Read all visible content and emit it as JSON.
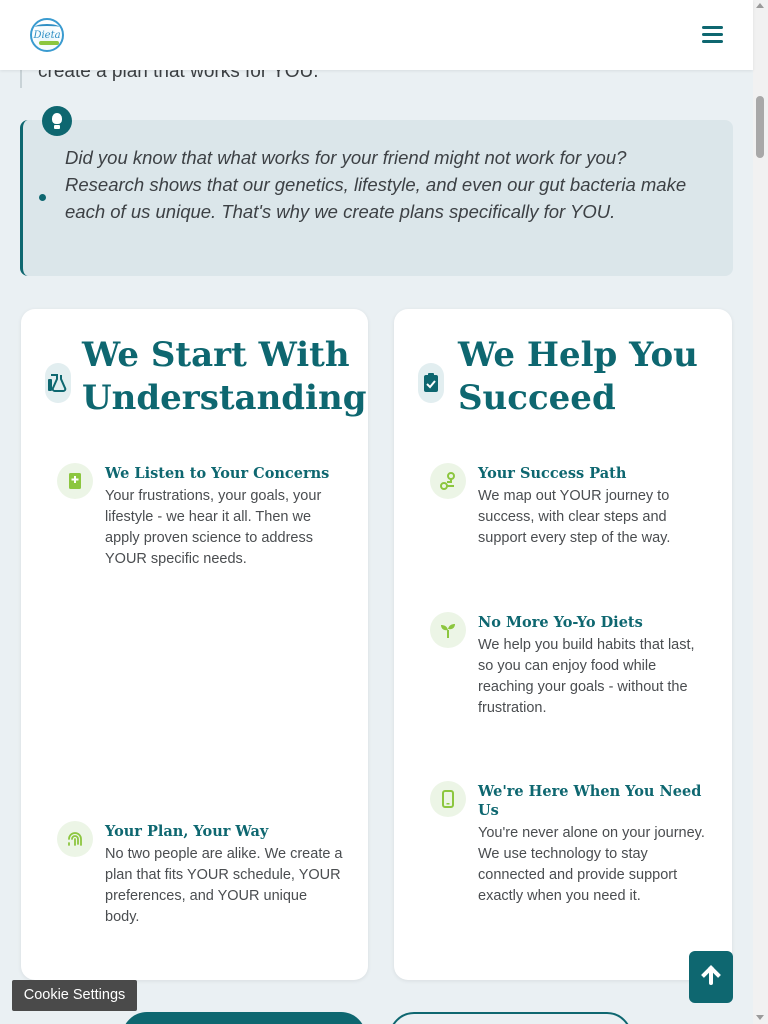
{
  "header": {
    "logo_text": "Dieta",
    "menu_icon": "hamburger-icon"
  },
  "intro": {
    "text": "create a plan that works for YOU."
  },
  "tip": {
    "icon": "lightbulb-icon",
    "text": "Did you know that what works for your friend might not work for you? Research shows that our genetics, lifestyle, and even our gut bacteria make each of us unique. That's why we create plans specifically for YOU."
  },
  "cards": {
    "left": {
      "icon": "flask-icon",
      "title_line1": "We Start With",
      "title_line2": "Understanding",
      "features": [
        {
          "icon": "book-plus-icon",
          "title": "We Listen to Your Concerns",
          "desc": "Your frustrations, your goals, your lifestyle - we hear it all. Then we apply proven science to address YOUR specific needs."
        },
        {
          "icon": "fingerprint-icon",
          "title": "Your Plan, Your Way",
          "desc": "No two people are alike. We create a plan that fits YOUR schedule, YOUR preferences, and YOUR unique body."
        }
      ]
    },
    "right": {
      "icon": "clipboard-check-icon",
      "title_line1": "We Help You",
      "title_line2": "Succeed",
      "features": [
        {
          "icon": "route-icon",
          "title": "Your Success Path",
          "desc": "We map out YOUR journey to success, with clear steps and support every step of the way."
        },
        {
          "icon": "seedling-icon",
          "title": "No More Yo-Yo Diets",
          "desc": "We help you build habits that last, so you can enjoy food while reaching your goals - without the frustration."
        },
        {
          "icon": "mobile-icon",
          "title_line1": "We're Here When You Need",
          "title_line2": "Us",
          "desc": "You're never alone on your journey. We use technology to stay connected and provide support exactly when you need it."
        }
      ]
    }
  },
  "cookie_settings": "Cookie Settings",
  "back_to_top_icon": "arrow-up-icon",
  "colors": {
    "brand": "#0e6770",
    "accent": "#8cc63f",
    "background": "#eaf0f3",
    "tip_background": "#dbe6ea"
  }
}
